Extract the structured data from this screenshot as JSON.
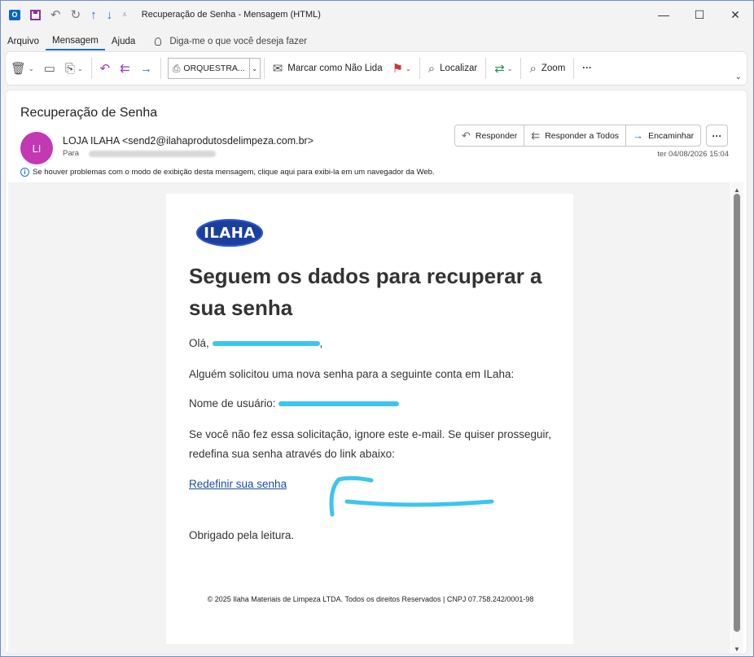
{
  "window": {
    "title": "Recuperação de Senha  -  Mensagem (HTML)"
  },
  "menu": {
    "items": [
      "Arquivo",
      "Mensagem",
      "Ajuda"
    ],
    "tell_me": "Diga-me o que você deseja fazer"
  },
  "ribbon": {
    "orquestra": "ORQUESTRA...",
    "mark_unread": "Marcar como Não Lida",
    "find": "Localizar",
    "zoom": "Zoom",
    "more": "···"
  },
  "message": {
    "subject": "Recuperação de Senha",
    "avatar_initials": "LI",
    "from": "LOJA ILAHA <send2@ilahaprodutosdelimpeza.com.br>",
    "to_label": "Para",
    "date": "ter 04/08/2026 15:04",
    "info": "Se houver problemas com o modo de exibição desta mensagem, clique aqui para exibi-la em um navegador da Web.",
    "actions": {
      "reply": "Responder",
      "reply_all": "Responder a Todos",
      "forward": "Encaminhar",
      "more": "···"
    }
  },
  "email": {
    "logo": "ILAHA",
    "headline": "Seguem os dados para recuperar a sua senha",
    "greeting": "Olá,",
    "greeting_end": ",",
    "line1": "Alguém solicitou uma nova senha para a seguinte conta em ILaha:",
    "username_label": "Nome de usuário:",
    "line3": "Se você não fez essa solicitação, ignore este e-mail. Se quiser prosseguir, redefina sua senha através do link abaixo:",
    "link": "Redefinir sua senha",
    "thanks": "Obrigado pela leitura.",
    "footer": "© 2025 Ilaha Materiais de Limpeza LTDA. Todos os direitos Reservados | CNPJ 07.758.242/0001-98"
  },
  "colors": {
    "accent": "#1a6fd6",
    "avatar": "#c239b3",
    "annotation": "#3cc5ee"
  }
}
